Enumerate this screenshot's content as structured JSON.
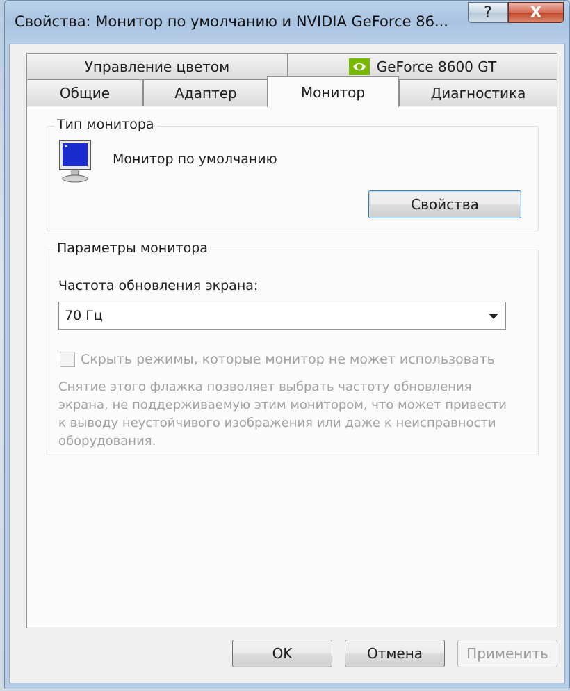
{
  "window": {
    "title": "Свойства: Монитор по умолчанию и NVIDIA GeForce 86...",
    "help_label": "?",
    "close_label": "X"
  },
  "tabs": {
    "row_top": [
      {
        "label": "Управление цветом"
      },
      {
        "label": "GeForce 8600 GT",
        "icon": "nvidia-logo-icon"
      }
    ],
    "row_bottom": [
      {
        "label": "Общие"
      },
      {
        "label": "Адаптер"
      },
      {
        "label": "Монитор",
        "selected": true
      },
      {
        "label": "Диагностика"
      }
    ]
  },
  "monitor_type": {
    "group_label": "Тип монитора",
    "monitor_name": "Монитор по умолчанию",
    "properties_button": "Свойства"
  },
  "monitor_settings": {
    "group_label": "Параметры монитора",
    "refresh_label": "Частота обновления экрана:",
    "refresh_value": "70 Гц",
    "hide_modes_label": "Скрыть режимы, которые монитор не может использовать",
    "hide_modes_checked": false,
    "help_text": "Снятие этого флажка позволяет выбрать частоту обновления экрана, не поддерживаемую этим монитором, что может привести к выводу неустойчивого изображения или даже к неисправности оборудования."
  },
  "footer": {
    "ok_label": "OK",
    "cancel_label": "Отмена",
    "apply_label": "Применить"
  },
  "colors": {
    "nvidia_green": "#76b900",
    "screen_blue": "#1a2bd0"
  }
}
